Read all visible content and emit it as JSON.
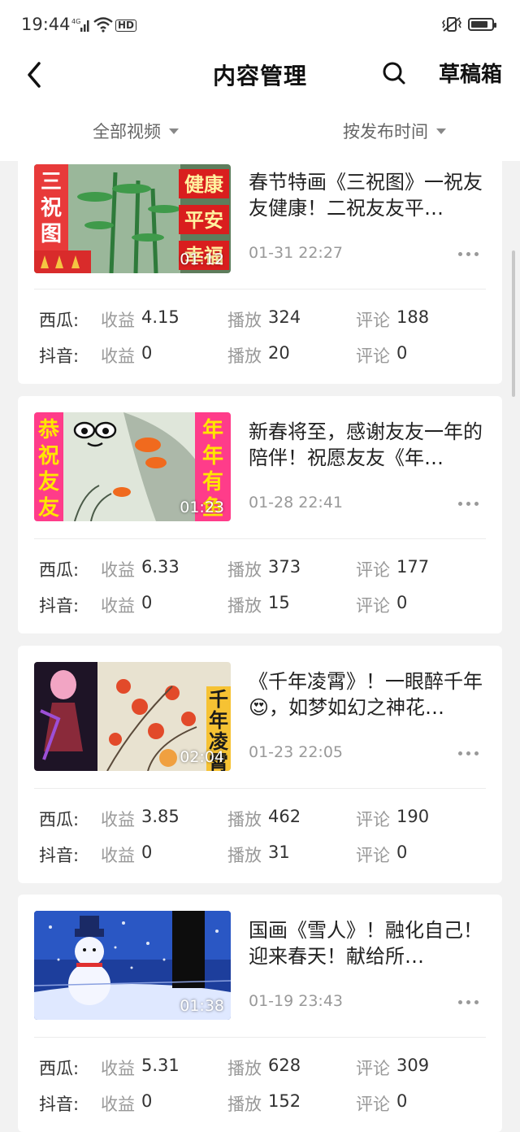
{
  "status_bar": {
    "time": "19:44",
    "network": "4G",
    "hd": "HD"
  },
  "nav": {
    "title": "内容管理",
    "drafts_label": "草稿箱"
  },
  "filters": {
    "video_filter": "全部视频",
    "sort_filter": "按发布时间"
  },
  "stat_labels": {
    "xigua": "西瓜:",
    "douyin": "抖音:",
    "income": "收益",
    "plays": "播放",
    "comments": "评论"
  },
  "videos": [
    {
      "title": "春节特画《三祝图》一祝友友健康！二祝友友平…",
      "date": "01-31 22:27",
      "duration": "01:12",
      "thumb_text": {
        "left": "三祝图",
        "r1": "健康",
        "r2": "平安",
        "r3": "幸福"
      },
      "xigua": {
        "income": "4.15",
        "plays": "324",
        "comments": "188"
      },
      "douyin": {
        "income": "0",
        "plays": "20",
        "comments": "0"
      }
    },
    {
      "title": "新春将至，感谢友友一年的陪伴！祝愿友友《年…",
      "date": "01-28 22:41",
      "duration": "01:23",
      "thumb_text": {
        "left": "恭祝友友",
        "right": "年年有鱼"
      },
      "xigua": {
        "income": "6.33",
        "plays": "373",
        "comments": "177"
      },
      "douyin": {
        "income": "0",
        "plays": "15",
        "comments": "0"
      }
    },
    {
      "title": "《千年凌霄》！一眼醉千年😍，如梦如幻之神花…",
      "date": "01-23 22:05",
      "duration": "02:04",
      "thumb_text": {
        "right": "千年凌霄"
      },
      "xigua": {
        "income": "3.85",
        "plays": "462",
        "comments": "190"
      },
      "douyin": {
        "income": "0",
        "plays": "31",
        "comments": "0"
      }
    },
    {
      "title": "国画《雪人》！融化自己！迎来春天！献给所…",
      "date": "01-19 23:43",
      "duration": "01:38",
      "xigua": {
        "income": "5.31",
        "plays": "628",
        "comments": "309"
      },
      "douyin": {
        "income": "0",
        "plays": "152",
        "comments": "0"
      }
    }
  ]
}
